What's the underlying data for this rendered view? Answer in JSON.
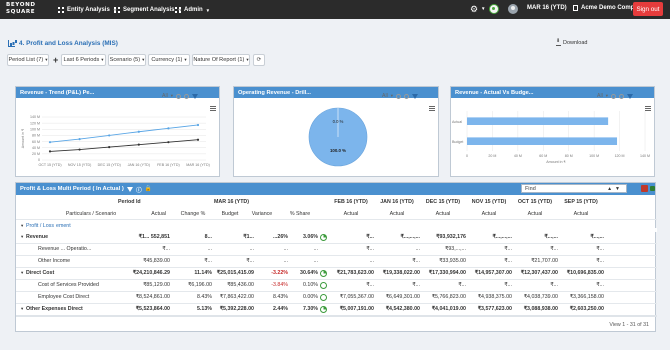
{
  "nav": {
    "logo_top": "BEYOND",
    "logo_bottom": "SQUARE",
    "entity": "Entity Analysis",
    "segment": "Segment Analysis",
    "admin": "Admin",
    "period": "MAR 16 (YTD)",
    "company": "Acme Demo Company",
    "signout": "Sign out",
    "icons": [
      "grid-icon",
      "gear-icon",
      "status-icon",
      "user-avatar",
      "building-icon"
    ]
  },
  "page": {
    "title": "4. Profit and Loss Analysis (MIS)",
    "download": "Download"
  },
  "toolbar": {
    "period_list": "Period List (7)",
    "periods": "Last 6 Periods",
    "scenario": "Scenario (5)",
    "currency": "Currency (1)",
    "nature": "Nature Of Report (1)"
  },
  "widgets": {
    "w1": {
      "title": "Revenue - Trend (P&L) Pe...",
      "filter": "All",
      "ylabel": "Amount in ₹",
      "y_ticks": [
        "140 M",
        "120 M",
        "100 M",
        "80 M",
        "60 M",
        "40 M",
        "20 M",
        "0"
      ],
      "x_ticks": [
        "OCT 15 (YTD)",
        "NOV 15 (YTD)",
        "DEC 15 (YTD)",
        "JAN 16 (YTD)",
        "FEB 16 (YTD)",
        "MAR 16 (YTD)"
      ]
    },
    "w2": {
      "title": "Operating Revenue - Drill...",
      "filter": "All",
      "small_label": "0.0 %",
      "big_label": "100.0 %"
    },
    "w3": {
      "title": "Revenue - Actual Vs Budge...",
      "filter": "All",
      "categories": [
        "Actual",
        "Budget"
      ],
      "x_ticks": [
        "0",
        "20 M",
        "40 M",
        "60 M",
        "80 M",
        "100 M",
        "120 M",
        "140 M"
      ],
      "xlabel": "Amount in ₹"
    }
  },
  "chart_data": [
    {
      "type": "line",
      "title": "Revenue - Trend (P&L) Pe...",
      "ylabel": "Amount in ₹",
      "x": [
        "OCT 15 (YTD)",
        "NOV 15 (YTD)",
        "DEC 15 (YTD)",
        "JAN 16 (YTD)",
        "FEB 16 (YTD)",
        "MAR 16 (YTD)"
      ],
      "ylim": [
        0,
        140
      ],
      "series": [
        {
          "values": [
            58,
            68,
            80,
            92,
            103,
            114
          ],
          "color": "#5aa6e6"
        },
        {
          "values": [
            28,
            34,
            42,
            50,
            58,
            66
          ],
          "color": "#333333"
        }
      ]
    },
    {
      "type": "pie",
      "title": "Operating Revenue - Drill...",
      "slices": [
        {
          "label": "0.0 %",
          "value": 0.0,
          "color": "#ffffff"
        },
        {
          "label": "100.0 %",
          "value": 100.0,
          "color": "#7cb5ec"
        }
      ]
    },
    {
      "type": "bar",
      "title": "Revenue - Actual Vs Budge...",
      "categories": [
        "Actual",
        "Budget"
      ],
      "values": [
        111,
        118
      ],
      "xlim": [
        0,
        140
      ],
      "xlabel": "Amount in ₹",
      "color": "#7cb5ec"
    }
  ],
  "table": {
    "title": "Profit & Loss Multi Period ( In Actual )",
    "find_placeholder": "Find",
    "period_id_label": "Period Id",
    "particulars_label": "Particulars / Scenario",
    "group_main": "MAR 16 (YTD)",
    "main_cols": [
      "Actual",
      "Change %",
      "Budget",
      "Variance",
      "% Share"
    ],
    "prior_cols": [
      "FEB 16 (YTD)",
      "JAN 16 (YTD)",
      "DEC 15 (YTD)",
      "NOV 15 (YTD)",
      "OCT 15 (YTD)",
      "SEP 15 (YTD)"
    ],
    "actual_label": "Actual",
    "tree_root": "Profit / Loss",
    "tree_root_tail": "ement",
    "rows": [
      {
        "label": "Revenue",
        "bold": true,
        "actual": "₹1... 552,851",
        "change": "8...",
        "budget": "₹1...",
        "variance": "...26%",
        "share": "3.06%",
        "p1": "₹...",
        "p2": "₹...,...,...",
        "p3": "₹93,932,176",
        "p4": "₹...,...,...",
        "p5": "₹...,...",
        "p6": "₹...,..."
      },
      {
        "label": "Revenue ... Operatio...",
        "bold": false,
        "actual": "₹...",
        "change": "...",
        "budget": "...",
        "variance": "...",
        "share": "...",
        "p1": "₹...",
        "p2": "...",
        "p3": "₹93,...,...",
        "p4": "₹...",
        "p5": "₹...",
        "p6": "₹..."
      },
      {
        "label": "Other Income",
        "bold": false,
        "actual": "₹45,839.00",
        "change": "₹...",
        "budget": "₹...",
        "variance": "...",
        "share": "...",
        "p1": "...",
        "p2": "₹...",
        "p3": "₹33,935.00",
        "p4": "₹...",
        "p5": "₹21,707.00",
        "p6": "₹..."
      },
      {
        "label": "Direct Cost",
        "bold": true,
        "actual": "₹24,210,846.29",
        "change": "11.14%",
        "budget": "₹25,015,415.09",
        "variance": "-3.22%",
        "share": "30.64%",
        "p1": "₹21,783,623.00",
        "p2": "₹19,338,022.00",
        "p3": "₹17,330,994.00",
        "p4": "₹14,957,307.00",
        "p5": "₹12,307,437.00",
        "p6": "₹10,696,835.00"
      },
      {
        "label": "Cost of Services Provided",
        "bold": false,
        "actual": "₹85,129.00",
        "change": "₹6,196.00",
        "budget": "₹85,436.00",
        "variance": "-3.84%",
        "share": "0.10%",
        "p1": "₹...",
        "p2": "₹...",
        "p3": "₹...",
        "p4": "₹...",
        "p5": "₹...",
        "p6": "₹..."
      },
      {
        "label": "Employee Cost Direct",
        "bold": false,
        "actual": "₹8,524,861.00",
        "change": "8.43%",
        "budget": "₹7,863,422.00",
        "variance": "8.43%",
        "share": "0.00%",
        "p1": "₹7,055,367.00",
        "p2": "₹6,649,301.00",
        "p3": "₹5,766,823.00",
        "p4": "₹4,938,375.00",
        "p5": "₹4,038,739.00",
        "p6": "₹3,366,158.00"
      },
      {
        "label": "Other Expenses Direct",
        "bold": true,
        "actual": "₹5,523,864.00",
        "change": "5.13%",
        "budget": "₹5,392,228.00",
        "variance": "2.44%",
        "share": "7.30%",
        "p1": "₹5,007,191.00",
        "p2": "₹4,542,380.00",
        "p3": "₹4,041,019.00",
        "p4": "₹3,577,623.00",
        "p5": "₹3,088,938.00",
        "p6": "₹2,603,250.00"
      }
    ],
    "footer": "View 1 - 31 of 31"
  }
}
